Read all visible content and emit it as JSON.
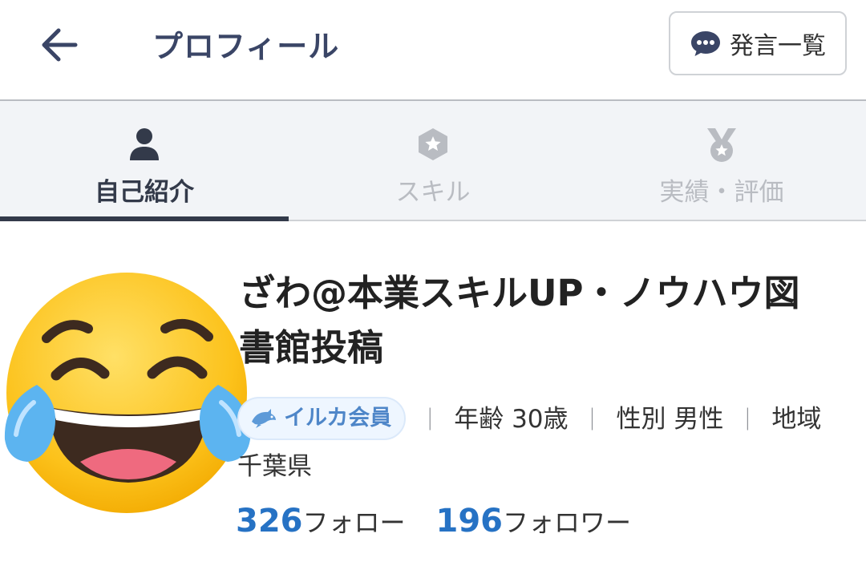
{
  "header": {
    "back_icon": "arrow-left-icon",
    "title": "プロフィール",
    "posts_button": {
      "icon": "speech-bubble-icon",
      "label": "発言一覧"
    }
  },
  "tabs": [
    {
      "label": "自己紹介",
      "icon": "person-icon",
      "active": true
    },
    {
      "label": "スキル",
      "icon": "hexagon-star-icon",
      "active": false
    },
    {
      "label": "実績・評価",
      "icon": "medal-icon",
      "active": false
    }
  ],
  "profile": {
    "avatar": "laughing-tears-emoji",
    "name": "ざわ@本業スキルUP・ノウハウ図書館投稿",
    "badge": {
      "icon": "dolphin-icon",
      "label": "イルカ会員"
    },
    "age_label": "年齢",
    "age_value": "30歳",
    "gender_label": "性別",
    "gender_value": "男性",
    "region_label": "地域",
    "region_value": "千葉県",
    "separator": "｜",
    "following_count": "326",
    "following_label": "フォロー",
    "followers_count": "196",
    "followers_label": "フォロワー"
  },
  "colors": {
    "accent": "#2672c4",
    "tab_active": "#333a4a",
    "tab_inactive": "#b9bcc2",
    "tab_bar_bg": "#f2f4f7",
    "badge_text": "#4e86c8"
  }
}
